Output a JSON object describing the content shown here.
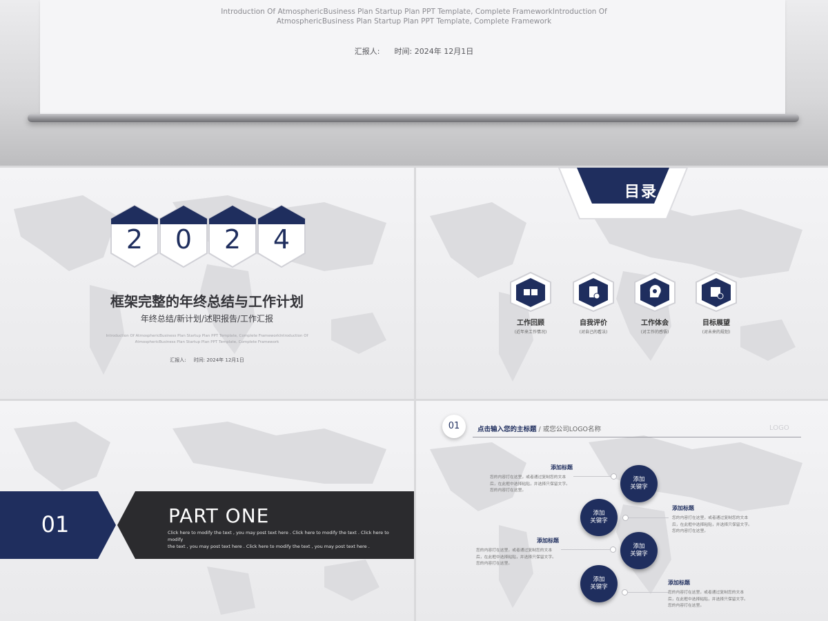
{
  "top_banner": {
    "subtitle_line1": "Introduction Of AtmosphericBusiness Plan Startup Plan PPT Template, Complete FrameworkIntroduction Of",
    "subtitle_line2": "AtmosphericBusiness Plan Startup Plan PPT Template, Complete Framework",
    "reporter_label": "汇报人:",
    "time_label": "时间: 2024年 12月1日"
  },
  "slide_cover": {
    "year_digits": [
      "2",
      "0",
      "2",
      "4"
    ],
    "title": "框架完整的年终总结与工作计划",
    "subtitle": "年终总结/新计划/述职报告/工作汇报",
    "intro_line1": "Introduction Of AtmosphericBusiness Plan Startup Plan PPT Template, Complete FrameworkIntroduction Of",
    "intro_line2": "AtmosphericBusiness Plan Startup Plan PPT Template, Complete Framework",
    "reporter_label": "汇报人:",
    "time_label": "时间: 2024年 12月1日"
  },
  "slide_toc": {
    "heading": "目录",
    "items": [
      {
        "label": "工作回顾",
        "desc": "(近年来工作情况)",
        "icon": "book-icon"
      },
      {
        "label": "自我评价",
        "desc": "(对自己的看法)",
        "icon": "clipboard-check-icon"
      },
      {
        "label": "工作体会",
        "desc": "(对工作的感悟)",
        "icon": "head-idea-icon"
      },
      {
        "label": "目标展望",
        "desc": "(对未来的规划)",
        "icon": "calendar-clock-icon"
      }
    ]
  },
  "slide_part": {
    "number": "01",
    "title": "PART ONE",
    "desc_line1": "Click here to modify the text , you may post text here . Click here to modify the text . Click here to modify",
    "desc_line2": "the text , you may post text here . Click here to modify the text , you may post text here ."
  },
  "slide_content": {
    "number": "01",
    "main_title": "点击输入您的主标题",
    "separator": " / ",
    "company": "或您公司LOGO名称",
    "logo_text": "LOGO",
    "keywords": [
      "添加\n关键字",
      "添加\n关键字",
      "添加\n关键字",
      "添加\n关键字"
    ],
    "text_blocks": [
      {
        "title": "添加标题",
        "body": "您的内容打在这里，或者通过复制您的文本后，在此框中选择粘贴，并选择只保留文字。您的内容打在这里。"
      },
      {
        "title": "添加标题",
        "body": "您的内容打在这里，或者通过复制您的文本后，在此框中选择粘贴，并选择只保留文字。您的内容打在这里。"
      },
      {
        "title": "添加标题",
        "body": "您的内容打在这里，或者通过复制您的文本后，在此框中选择粘贴，并选择只保留文字。您的内容打在这里。"
      },
      {
        "title": "添加标题",
        "body": "您的内容打在这里，或者通过复制您的文本后，在此框中选择粘贴，并选择只保留文字。您的内容打在这里。"
      }
    ]
  },
  "colors": {
    "accent": "#1f2e5e",
    "dark": "#2b2b2e",
    "background": "#f2f2f4"
  }
}
